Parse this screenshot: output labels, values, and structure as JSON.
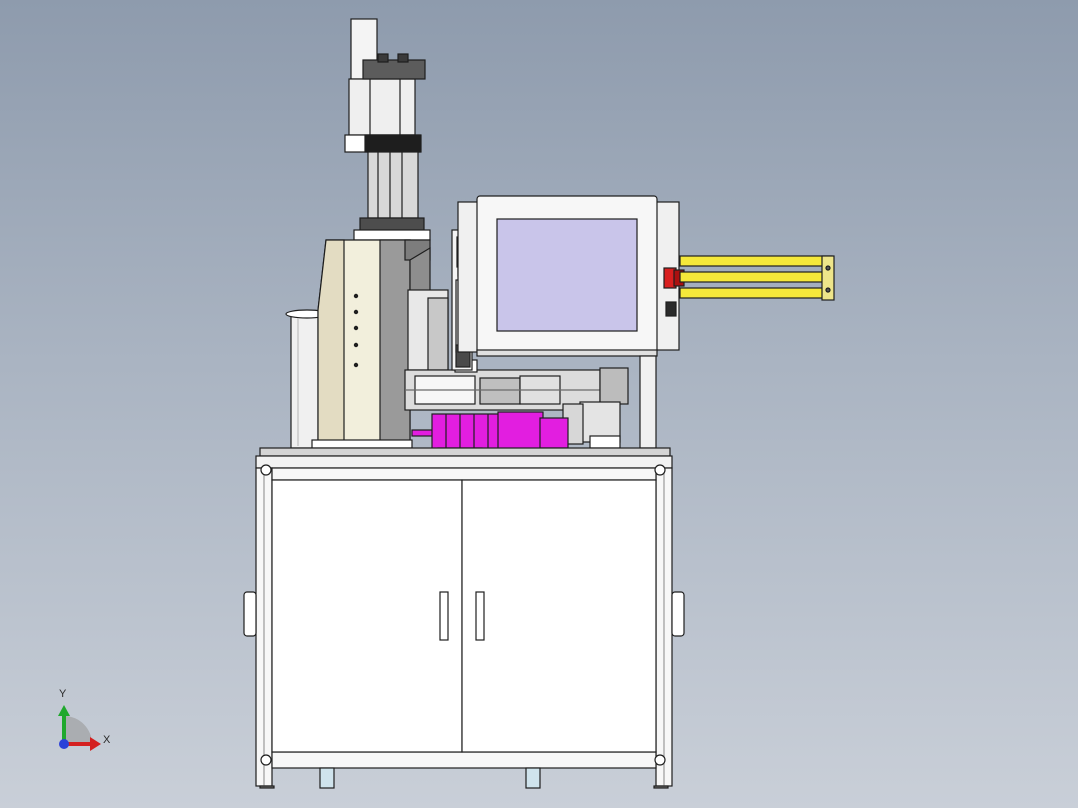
{
  "viewport": {
    "background_top": "#8e9bad",
    "background_bottom": "#c9cfd8"
  },
  "model": {
    "parts": [
      "pneumatic-press-cylinder",
      "press-ram-column",
      "hmi-touch-screen",
      "emergency-stop-button",
      "safety-light-curtain",
      "servo-gear-motor",
      "cabinet-base",
      "cabinet-door-left",
      "cabinet-door-right",
      "side-handle-left",
      "side-handle-right",
      "leveling-foot"
    ],
    "colors": {
      "frame": "#ffffff",
      "outline": "#1e1e1e",
      "motor": "#e21ee0",
      "light_curtain": "#f5e83a",
      "estop": "#d81f1f",
      "screen": "#c9c5ea",
      "column": "#f2efdc",
      "teal_sensor": "#2fd3cf"
    }
  },
  "triad": {
    "x_label": "X",
    "y_label": "Y",
    "x_color": "#d42020",
    "y_color": "#1fa82c",
    "origin_color": "#2a40d8"
  }
}
